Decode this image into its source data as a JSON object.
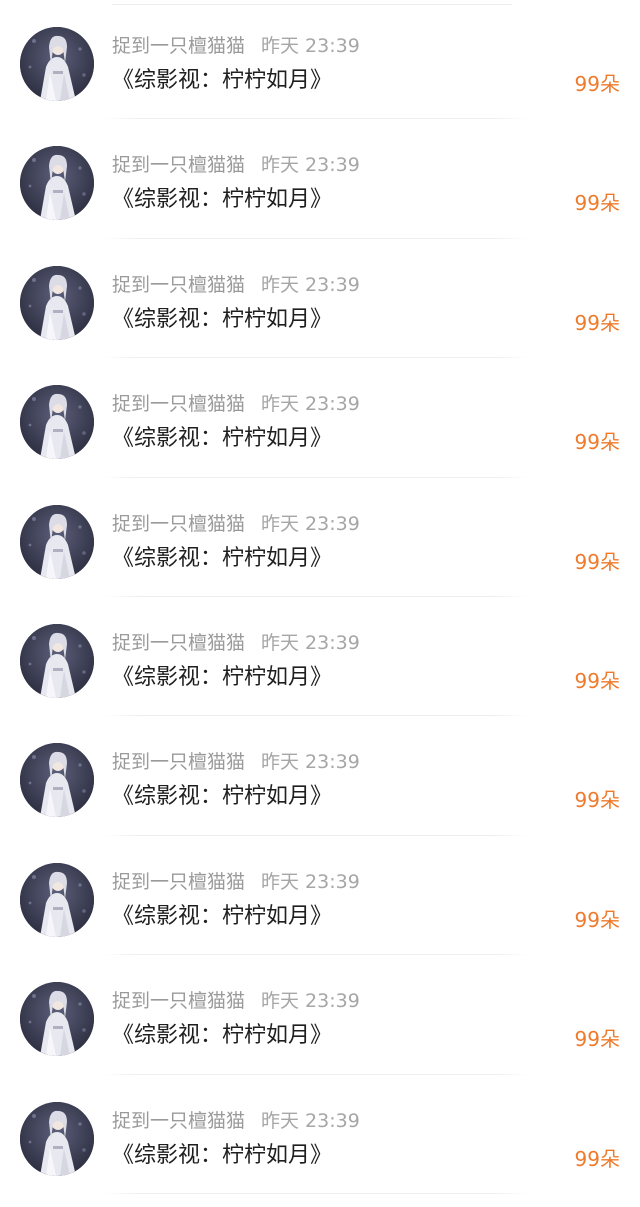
{
  "comments": [
    {
      "author": "捉到一只檀猫猫",
      "time": "昨天 23:39",
      "text": "《综影视：柠柠如月》",
      "flowers": "99朵",
      "avatar_icon": "avatar-portrait-icon"
    },
    {
      "author": "捉到一只檀猫猫",
      "time": "昨天 23:39",
      "text": "《综影视：柠柠如月》",
      "flowers": "99朵",
      "avatar_icon": "avatar-portrait-icon"
    },
    {
      "author": "捉到一只檀猫猫",
      "time": "昨天 23:39",
      "text": "《综影视：柠柠如月》",
      "flowers": "99朵",
      "avatar_icon": "avatar-portrait-icon"
    },
    {
      "author": "捉到一只檀猫猫",
      "time": "昨天 23:39",
      "text": "《综影视：柠柠如月》",
      "flowers": "99朵",
      "avatar_icon": "avatar-portrait-icon"
    },
    {
      "author": "捉到一只檀猫猫",
      "time": "昨天 23:39",
      "text": "《综影视：柠柠如月》",
      "flowers": "99朵",
      "avatar_icon": "avatar-portrait-icon"
    },
    {
      "author": "捉到一只檀猫猫",
      "time": "昨天 23:39",
      "text": "《综影视：柠柠如月》",
      "flowers": "99朵",
      "avatar_icon": "avatar-portrait-icon"
    },
    {
      "author": "捉到一只檀猫猫",
      "time": "昨天 23:39",
      "text": "《综影视：柠柠如月》",
      "flowers": "99朵",
      "avatar_icon": "avatar-portrait-icon"
    },
    {
      "author": "捉到一只檀猫猫",
      "time": "昨天 23:39",
      "text": "《综影视：柠柠如月》",
      "flowers": "99朵",
      "avatar_icon": "avatar-portrait-icon"
    },
    {
      "author": "捉到一只檀猫猫",
      "time": "昨天 23:39",
      "text": "《综影视：柠柠如月》",
      "flowers": "99朵",
      "avatar_icon": "avatar-portrait-icon"
    },
    {
      "author": "捉到一只檀猫猫",
      "time": "昨天 23:39",
      "text": "《综影视：柠柠如月》",
      "flowers": "99朵",
      "avatar_icon": "avatar-portrait-icon"
    }
  ],
  "colors": {
    "author": "#9a9a9a",
    "time": "#a6a6a6",
    "text": "#1f1f1f",
    "flowers": "#ef7a2b",
    "divider": "#eeeeee"
  }
}
